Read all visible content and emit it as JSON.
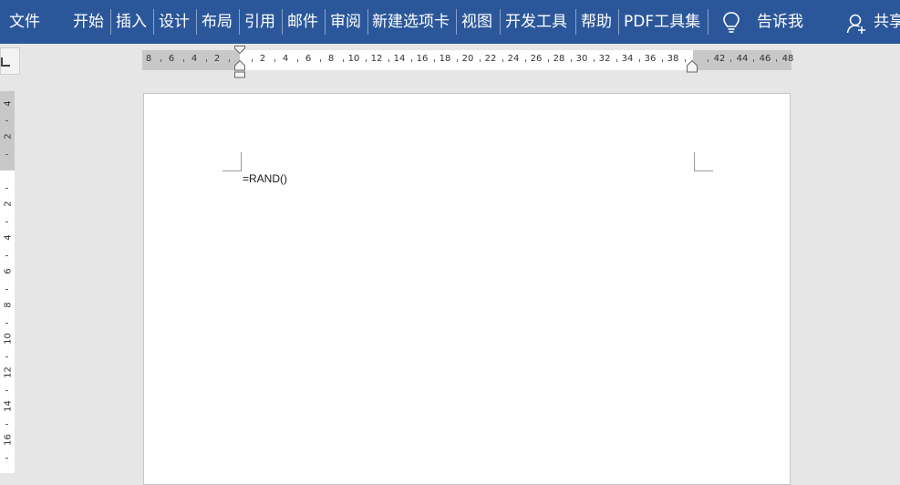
{
  "ribbon": {
    "tabs": [
      {
        "id": "file",
        "label": "文件"
      },
      {
        "id": "home",
        "label": "开始"
      },
      {
        "id": "insert",
        "label": "插入"
      },
      {
        "id": "design",
        "label": "设计"
      },
      {
        "id": "layout",
        "label": "布局"
      },
      {
        "id": "references",
        "label": "引用"
      },
      {
        "id": "mailings",
        "label": "邮件"
      },
      {
        "id": "review",
        "label": "审阅"
      },
      {
        "id": "newtab",
        "label": "新建选项卡"
      },
      {
        "id": "view",
        "label": "视图"
      },
      {
        "id": "developer",
        "label": "开发工具"
      },
      {
        "id": "help",
        "label": "帮助"
      },
      {
        "id": "pdf",
        "label": "PDF工具集"
      }
    ],
    "tell_me": "告诉我",
    "share": "共享",
    "background": "#2b579a"
  },
  "ruler": {
    "left_labels": [
      "8",
      "6",
      "4",
      "2"
    ],
    "right_labels": [
      "2",
      "4",
      "6",
      "8",
      "10",
      "12",
      "14",
      "16",
      "18",
      "20",
      "22",
      "24",
      "26",
      "28",
      "30",
      "32",
      "34",
      "36",
      "38"
    ],
    "margin_labels": [
      "42",
      "44",
      "46",
      "48"
    ],
    "vertical_labels": [
      "4",
      "2",
      "2",
      "4",
      "6",
      "8",
      "10",
      "12",
      "14",
      "16"
    ]
  },
  "document": {
    "text": "=RAND()"
  }
}
